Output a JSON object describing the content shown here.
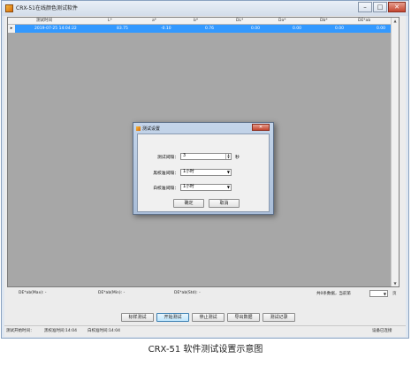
{
  "window": {
    "title": "CRX-51在线颜色测试软件",
    "controls": {
      "minimize": "–",
      "maximize": "□",
      "close": "✕"
    }
  },
  "grid": {
    "columns": [
      "测试时间",
      "L*",
      "a*",
      "b*",
      "DL*",
      "Da*",
      "Db*",
      "DE*ab"
    ],
    "rows": [
      {
        "marker": "▸",
        "cells": [
          "2019-07-25 14:04:22",
          "83.75",
          "-0.10",
          "0.76",
          "0.00",
          "0.00",
          "0.00",
          "0.00"
        ]
      }
    ]
  },
  "stats": {
    "max": "DE*ab(Max): -",
    "min": "DE*ab(Min): -",
    "std": "DE*ab(Std): -",
    "count": "共0条数据，当前第",
    "page_unit": "页"
  },
  "buttons": {
    "standard": "标样测试",
    "start": "开始测试",
    "stop": "停止测试",
    "export": "导出数据",
    "records": "测试记录"
  },
  "status": {
    "start_time": "测试开始时间：",
    "black_cal": "黑校准时间:14:04",
    "white_cal": "白校准时间:14:04",
    "device": "设备已连接"
  },
  "dialog": {
    "title": "测试设置",
    "close": "✕",
    "interval_label": "测试间隔：",
    "interval_value": "3",
    "interval_unit": "秒",
    "black_label": "黑校准间隔：",
    "black_value": "1小时",
    "white_label": "白校准间隔：",
    "white_value": "1小时",
    "ok": "确定",
    "cancel": "取消"
  },
  "caption": "CRX-51 软件测试设置示意图"
}
